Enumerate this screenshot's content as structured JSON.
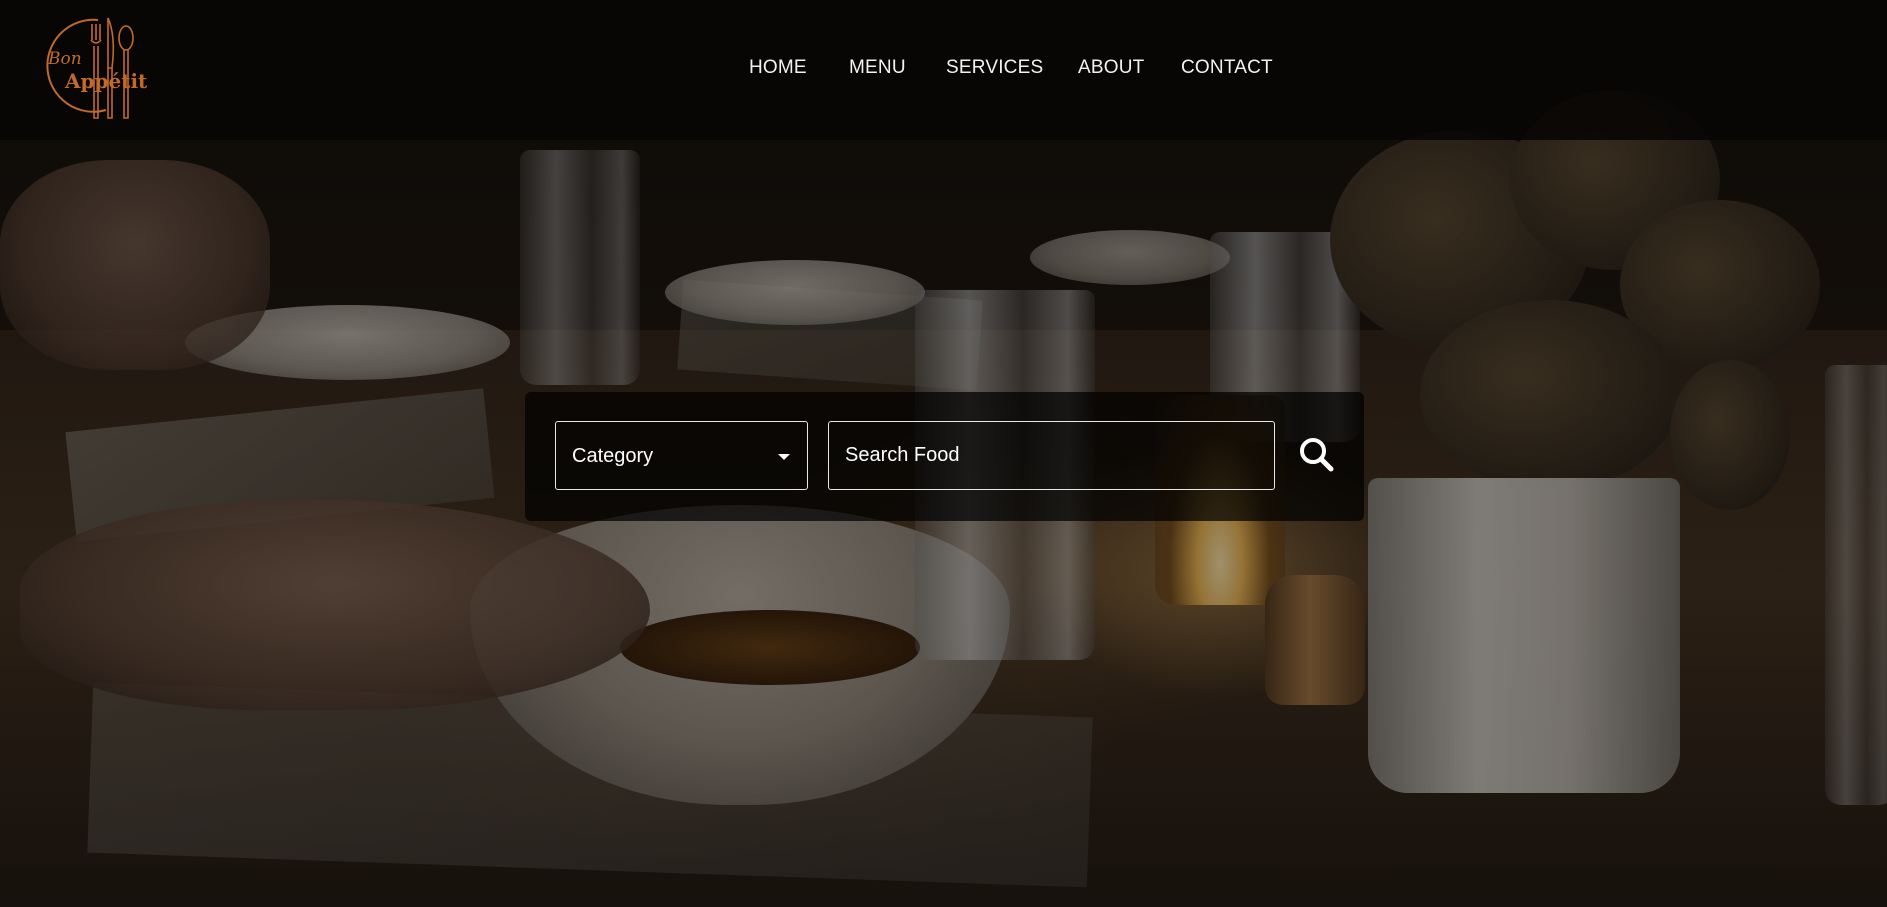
{
  "brand": {
    "logo_top_text": "Bon",
    "logo_main_text": "Appétit",
    "logo_accent_color": "#c06a2c"
  },
  "nav": {
    "items": [
      {
        "label": "HOME"
      },
      {
        "label": "MENU"
      },
      {
        "label": "SERVICES"
      },
      {
        "label": "ABOUT"
      },
      {
        "label": "CONTACT"
      }
    ]
  },
  "search": {
    "category_label": "Category",
    "placeholder": "Search Food",
    "button_icon": "search-icon"
  },
  "colors": {
    "header_bg": "#080604",
    "text": "#ffffff",
    "panel_bg": "#000000"
  }
}
